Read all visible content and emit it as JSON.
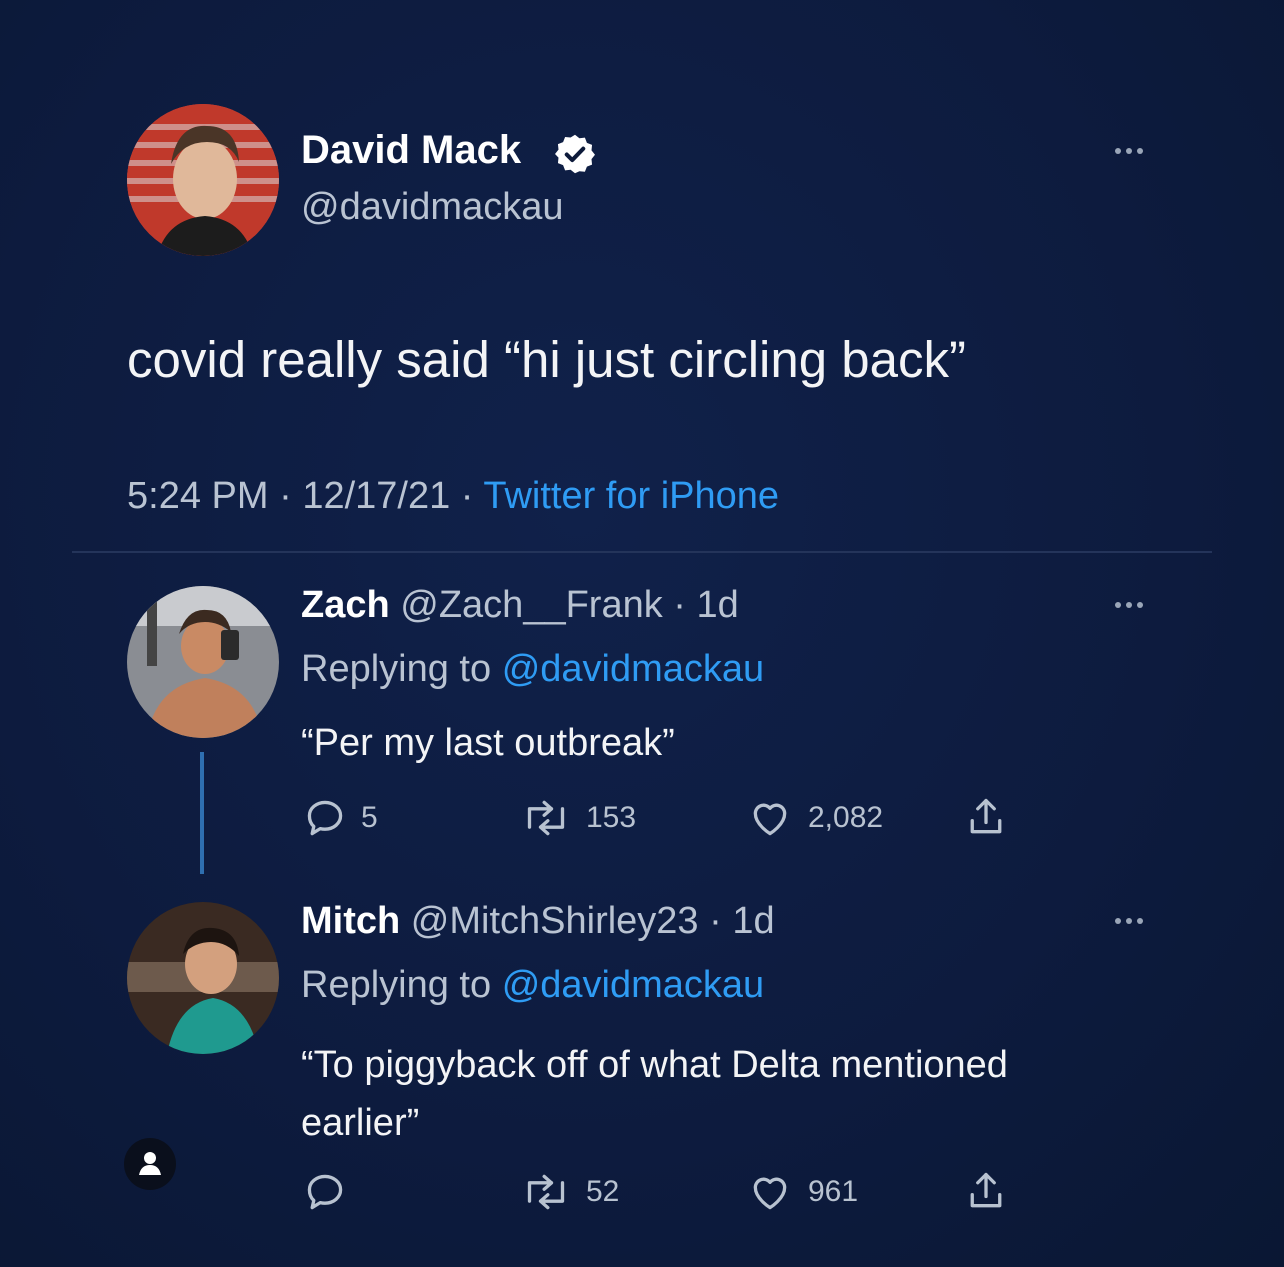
{
  "tweet": {
    "author_name": "David Mack",
    "author_handle": "@davidmackau",
    "text": "covid really said “hi just circling back”",
    "time": "5:24 PM",
    "separator1": "·",
    "date": "12/17/21",
    "separator2": "·",
    "source": "Twitter for iPhone"
  },
  "replies": [
    {
      "name": "Zach",
      "handle": "@Zach__Frank",
      "age": "· 1d",
      "replying_prefix": "Replying to",
      "replying_to": "@davidmackau",
      "text": "“Per my last outbreak”",
      "reply_count": "5",
      "retweet_count": "153",
      "like_count": "2,082"
    },
    {
      "name": "Mitch",
      "handle": "@MitchShirley23",
      "age": "· 1d",
      "replying_prefix": "Replying to",
      "replying_to": "@davidmackau",
      "text_line1": "“To piggyback off of what Delta mentioned",
      "text_line2": "earlier”",
      "reply_count": "",
      "retweet_count": "52",
      "like_count": "961"
    }
  ],
  "colors": {
    "background": "#0d1a3a",
    "link": "#2f9cf4",
    "muted": "#9aa6b8",
    "verified": "#ffffff"
  },
  "icons": [
    "more-icon",
    "verified-icon",
    "reply-icon",
    "retweet-icon",
    "like-icon",
    "share-icon",
    "person-icon"
  ]
}
